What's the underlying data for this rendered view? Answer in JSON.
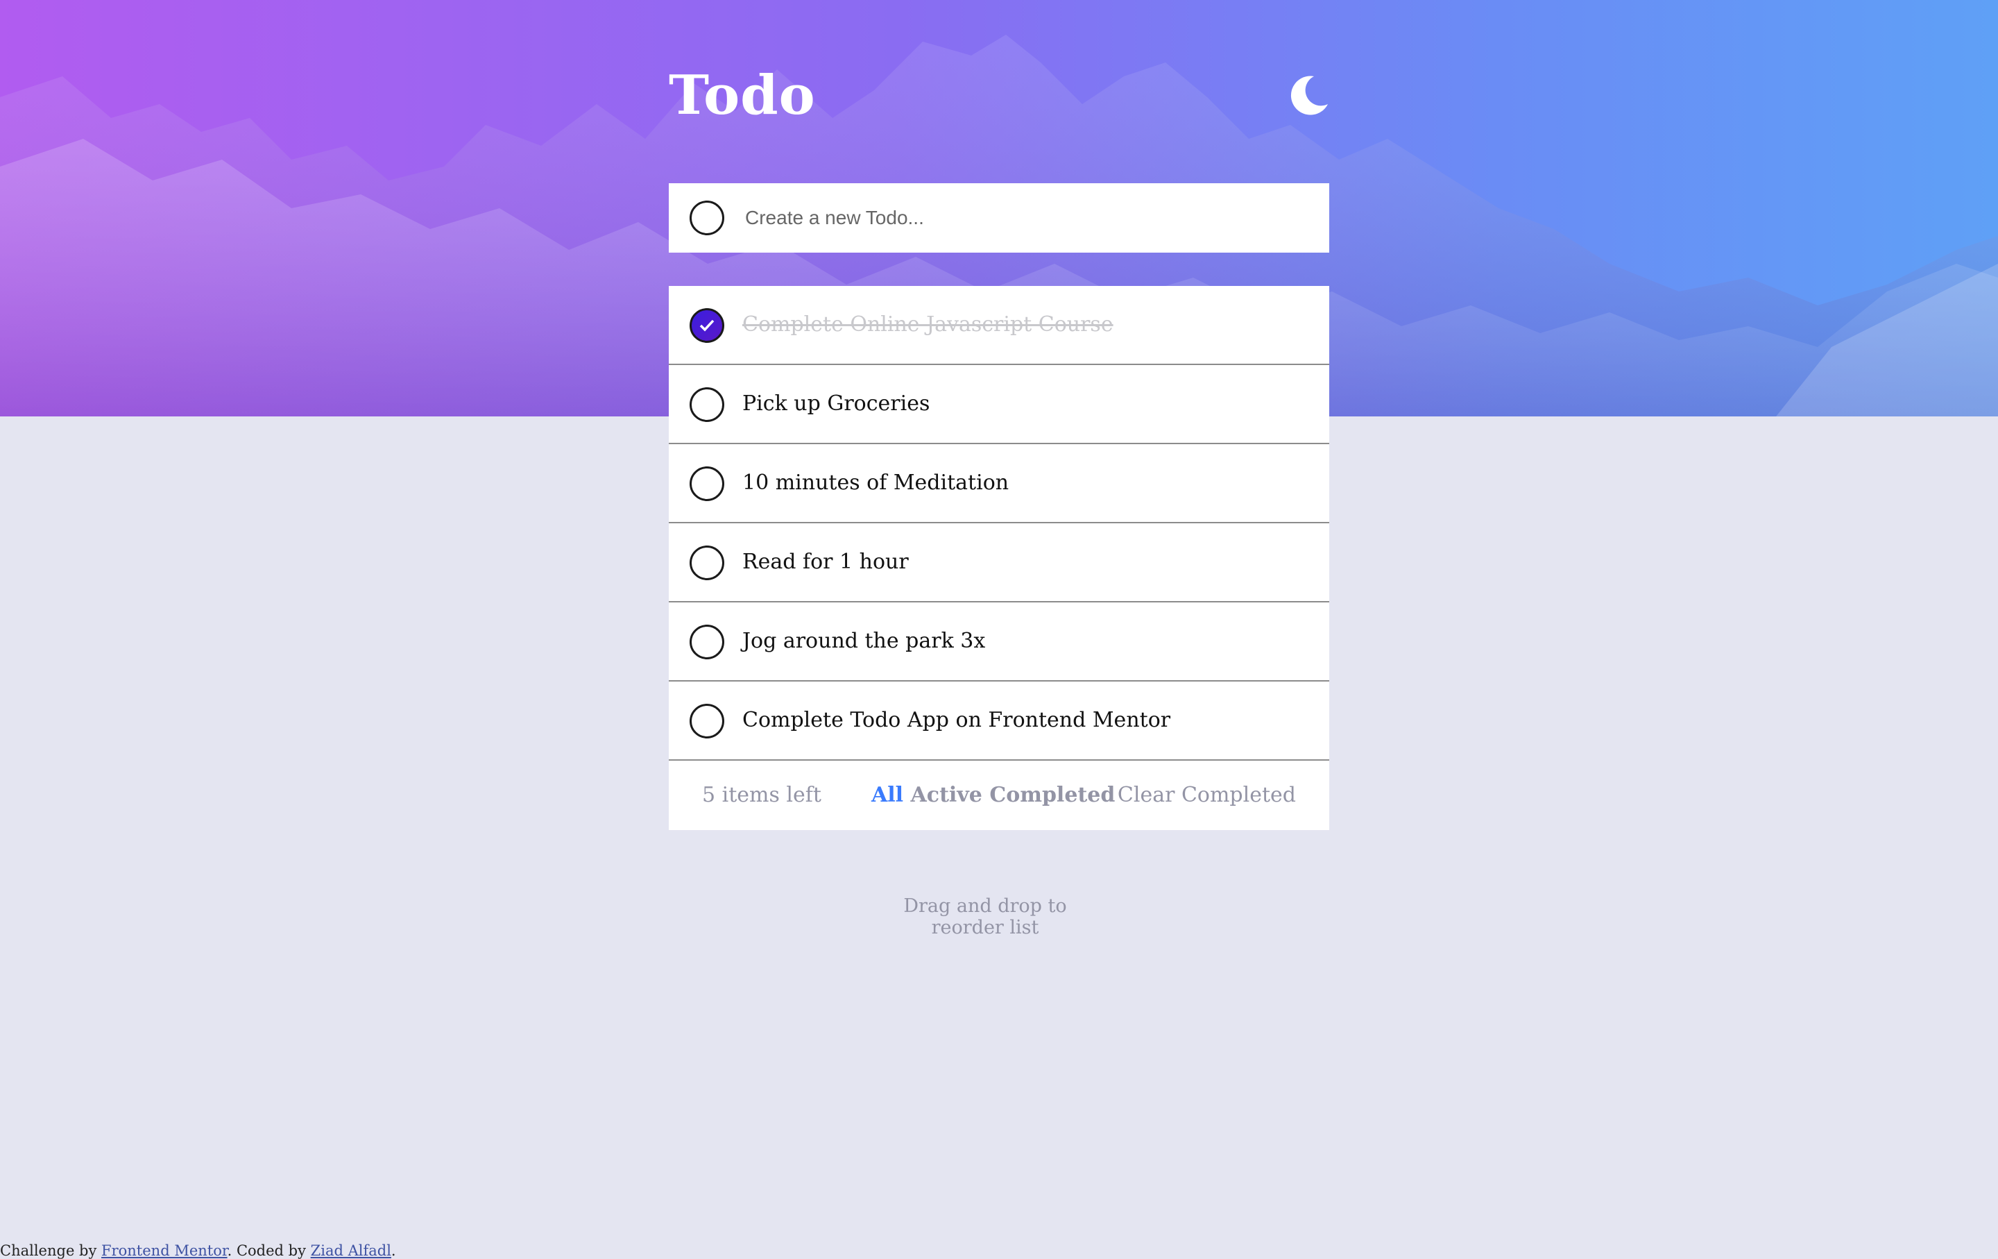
{
  "header": {
    "title": "Todo",
    "theme_icon": "moon-icon"
  },
  "new_todo": {
    "placeholder": "Create a new Todo..."
  },
  "todos": [
    {
      "label": "Complete Online Javascript Course",
      "completed": true
    },
    {
      "label": "Pick up Groceries",
      "completed": false
    },
    {
      "label": "10 minutes of Meditation",
      "completed": false
    },
    {
      "label": "Read for 1 hour",
      "completed": false
    },
    {
      "label": "Jog around the park 3x",
      "completed": false
    },
    {
      "label": "Complete Todo App on Frontend Mentor",
      "completed": false
    }
  ],
  "footer": {
    "items_left": "5 items left",
    "filters": [
      {
        "label": "All",
        "active": true
      },
      {
        "label": "Active",
        "active": false
      },
      {
        "label": "Completed",
        "active": false
      }
    ],
    "clear_label": "Clear Completed"
  },
  "hint": "Drag and drop to reorder list",
  "attribution": {
    "prefix": "Challenge by ",
    "link1": "Frontend Mentor",
    "middle": ". Coded by ",
    "link2": "Ziad Alfadl",
    "suffix": "."
  },
  "colors": {
    "accent": "#3a7bfd",
    "check_gradient_start": "#3b1ee0",
    "page_bg": "#e4e5f1",
    "muted_text": "#9394a5"
  }
}
